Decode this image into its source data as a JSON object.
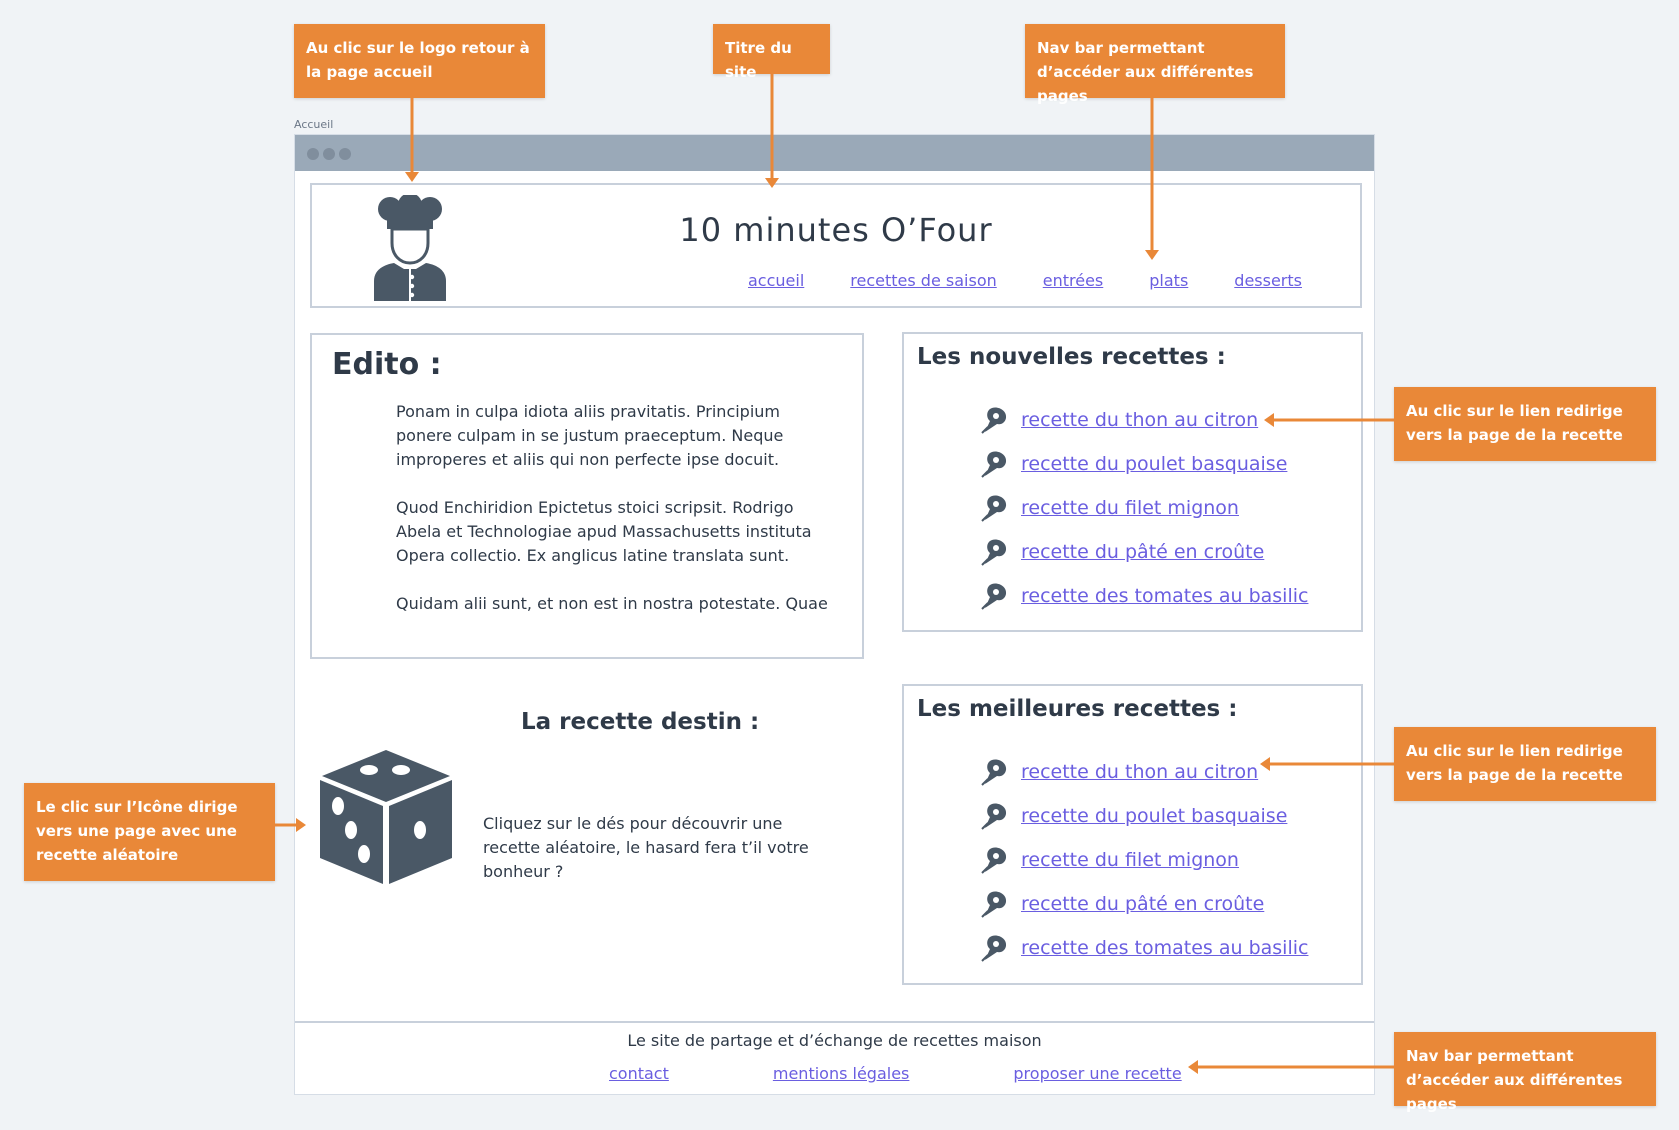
{
  "page_label": "Accueil",
  "site": {
    "title": "10 minutes O’Four",
    "nav": [
      "accueil",
      "recettes de saison",
      "entrées",
      "plats",
      "desserts"
    ]
  },
  "edito": {
    "title": "Edito :",
    "paragraphs": [
      "Ponam in culpa idiota aliis pravitatis. Principium ponere culpam in se justum praeceptum. Neque improperes et aliis qui non perfecte ipse docuit.",
      "Quod Enchiridion Epictetus stoici scripsit. Rodrigo Abela et Technologiae apud Massachusetts instituta Opera collectio. Ex anglicus latine translata sunt.",
      "Quidam alii sunt, et non est in nostra potestate. Quae"
    ]
  },
  "new_recipes": {
    "title": "Les nouvelles recettes :",
    "items": [
      "recette du thon au citron",
      "recette du poulet basquaise",
      "recette du filet mignon",
      "recette du pâté en croûte",
      "recette des tomates au basilic"
    ]
  },
  "best_recipes": {
    "title": "Les meilleures recettes :",
    "items": [
      "recette du thon au citron",
      "recette du poulet basquaise",
      "recette du filet mignon",
      "recette du pâté en croûte",
      "recette des tomates au basilic"
    ]
  },
  "destin": {
    "title": "La recette destin :",
    "text": "Cliquez sur le dés pour découvrir une recette aléatoire, le hasard fera t’il votre bonheur ?"
  },
  "footer": {
    "text": "Le site de partage et d’échange de recettes maison",
    "nav": [
      "contact",
      "mentions légales",
      "proposer une recette"
    ]
  },
  "annotations": {
    "logo": "Au clic sur le logo retour à la page accueil",
    "title": "Titre du site",
    "nav": "Nav bar permettant d’accéder aux différentes pages",
    "recipe_link_1": "Au clic sur le lien redirige vers la page de la recette",
    "recipe_link_2": "Au clic sur le lien redirige vers la page de la recette",
    "dice": "Le clic sur l’Icône dirige vers une page avec une recette aléatoire",
    "footer_nav": "Nav bar permettant d’accéder aux différentes pages"
  },
  "colors": {
    "annotation": "#e98838",
    "link": "#6a5ee0",
    "icon": "#4a5866",
    "titlebar": "#9aa9b8"
  }
}
